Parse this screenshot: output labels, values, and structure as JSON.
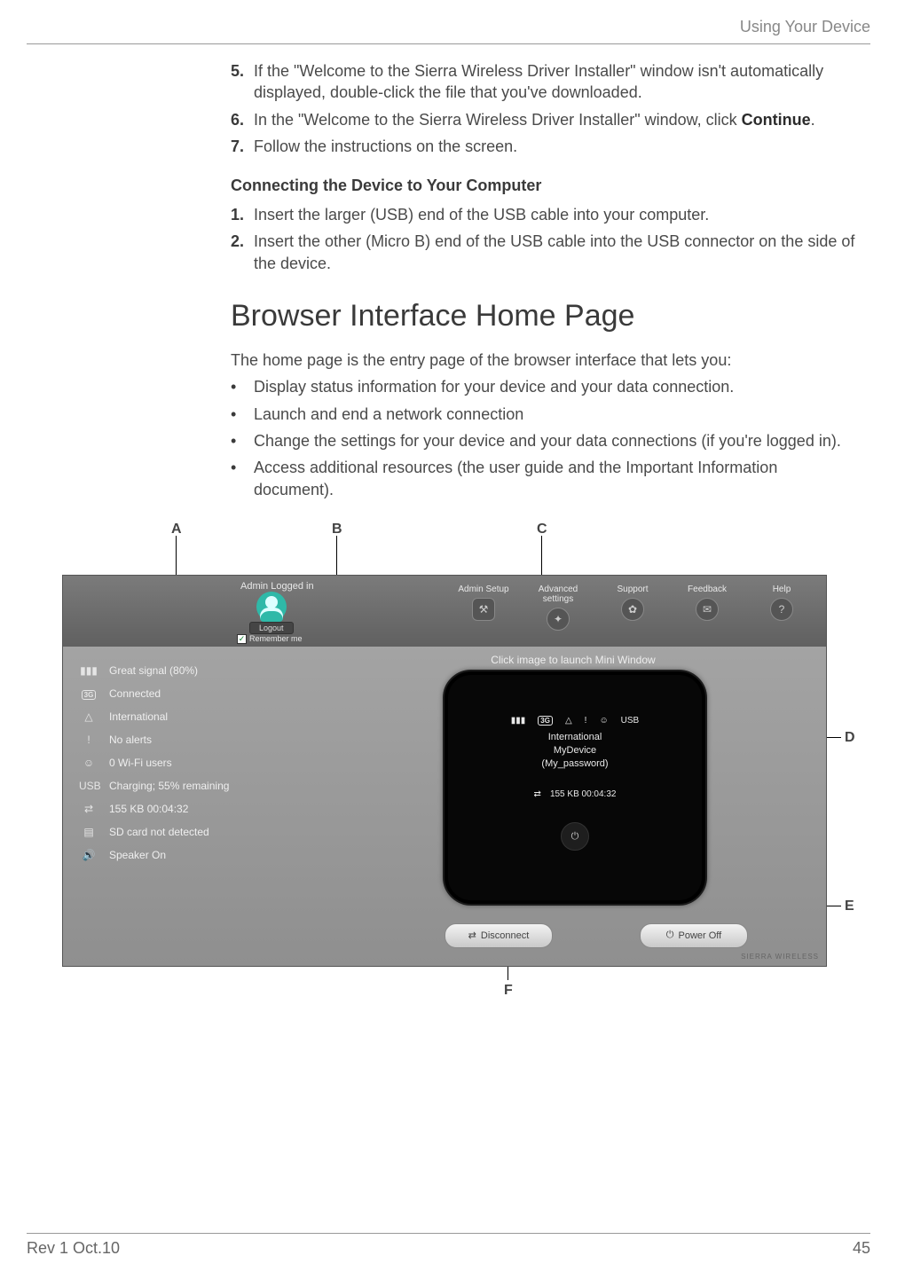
{
  "header": {
    "running_head": "Using Your Device"
  },
  "steps_top": [
    {
      "num": "5.",
      "text": "If the \"Welcome to the Sierra Wireless Driver Installer\" window isn't automatically displayed, double-click the file that you've downloaded."
    },
    {
      "num": "6.",
      "text_prefix": "In the \"Welcome to the Sierra Wireless Driver Installer\" window, click ",
      "bold": "Continue",
      "text_suffix": "."
    },
    {
      "num": "7.",
      "text": "Follow the instructions on the screen."
    }
  ],
  "subhead": "Connecting the Device to Your Computer",
  "steps_connect": [
    {
      "num": "1.",
      "text": "Insert the larger (USB) end of the USB cable into your computer."
    },
    {
      "num": "2.",
      "text": "Insert the other (Micro B) end of the USB cable into the USB connector on the side of the device."
    }
  ],
  "h1": "Browser Interface Home Page",
  "intro": "The home page is the entry page of the browser interface that lets you:",
  "bullets": [
    "Display status information for your device and your data connection.",
    "Launch and end a network connection",
    "Change the settings for your device and your data connections (if you're logged in).",
    "Access additional resources (the user guide and the Important Information document)."
  ],
  "callouts": {
    "A": "A",
    "B": "B",
    "C": "C",
    "D": "D",
    "E": "E",
    "F": "F"
  },
  "ui": {
    "admin_logged_in": "Admin Logged in",
    "logout": "Logout",
    "remember_me": "Remember me",
    "nav": [
      {
        "label": "Admin Setup"
      },
      {
        "label": "Advanced settings"
      },
      {
        "label": "Support"
      },
      {
        "label": "Feedback"
      },
      {
        "label": "Help"
      }
    ],
    "status": [
      {
        "icon": "signal",
        "text": "Great signal (80%)"
      },
      {
        "icon": "3g",
        "text": "Connected"
      },
      {
        "icon": "roaming",
        "text": "International"
      },
      {
        "icon": "alert",
        "text": "No alerts"
      },
      {
        "icon": "wifi-users",
        "text": "0 Wi-Fi users"
      },
      {
        "icon": "usb",
        "text": "Charging; 55% remaining"
      },
      {
        "icon": "data",
        "text": "155 KB   00:04:32"
      },
      {
        "icon": "sd",
        "text": "SD card not detected"
      },
      {
        "icon": "speaker",
        "text": "Speaker On"
      }
    ],
    "mini_caption": "Click image to launch Mini Window",
    "mini": {
      "line1": "International",
      "line2": "MyDevice",
      "line3": "(My_password)",
      "data": "155 KB   00:04:32"
    },
    "disconnect": "Disconnect",
    "power_off": "Power Off",
    "brand": "SIERRA WIRELESS"
  },
  "footer": {
    "left": "Rev 1  Oct.10",
    "right": "45"
  }
}
